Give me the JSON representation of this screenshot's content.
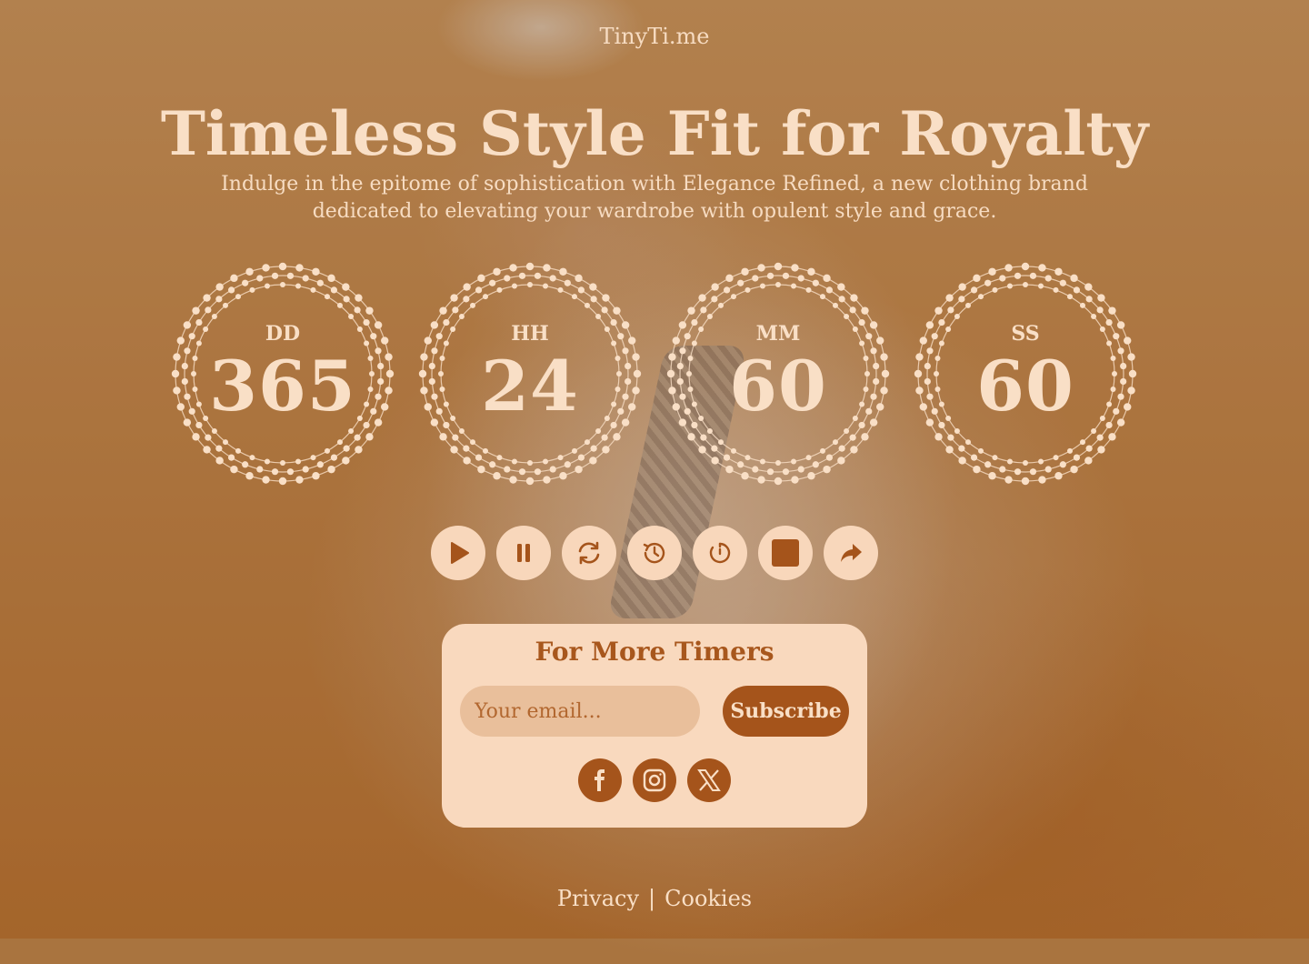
{
  "brand": "TinyTi.me",
  "hero": {
    "title": "Timeless Style Fit for Royalty",
    "subtitle": "Indulge in the epitome of sophistication with Elegance Refined, a new clothing brand dedicated to elevating your wardrobe with opulent style and grace."
  },
  "countdown": [
    {
      "label": "DD",
      "value": "365"
    },
    {
      "label": "HH",
      "value": "24"
    },
    {
      "label": "MM",
      "value": "60"
    },
    {
      "label": "SS",
      "value": "60"
    }
  ],
  "controls": [
    {
      "name": "play",
      "icon": "play-icon"
    },
    {
      "name": "pause",
      "icon": "pause-icon"
    },
    {
      "name": "restart",
      "icon": "refresh-icon"
    },
    {
      "name": "history",
      "icon": "history-icon"
    },
    {
      "name": "timer",
      "icon": "timer-icon"
    },
    {
      "name": "stop",
      "icon": "stop-icon"
    },
    {
      "name": "share",
      "icon": "share-icon"
    }
  ],
  "subscribe": {
    "title": "For More Timers",
    "email_placeholder": "Your email...",
    "button_label": "Subscribe"
  },
  "social": [
    {
      "name": "facebook",
      "icon": "facebook-icon"
    },
    {
      "name": "instagram",
      "icon": "instagram-icon"
    },
    {
      "name": "x",
      "icon": "x-icon"
    }
  ],
  "footer": {
    "privacy": "Privacy",
    "separator": "|",
    "cookies": "Cookies"
  },
  "colors": {
    "accent": "#a5541b",
    "light": "#f9dfc6",
    "card": "#f9d9be"
  }
}
